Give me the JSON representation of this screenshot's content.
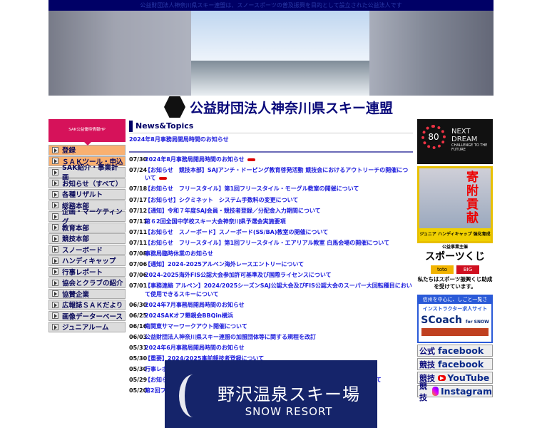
{
  "top_banner": "公益財団法人神奈川県スキー連盟は、スノースポーツの普及振興を目的として設立された公益法人です",
  "org_name": "公益財団法人神奈川県スキー連盟",
  "left": {
    "banner": "SAK公益優待情報HP",
    "menu": [
      "登録",
      "ＳＡＫツール・申込",
      "SAK紹介・事業計画",
      "お知らせ（すべて）",
      "各種リザルト",
      "総務本部",
      "企画・マーケティング",
      "教育本部",
      "競技本部",
      "スノーボード",
      "ハンディキャップ",
      "行事レポート",
      "協会とクラブの紹介",
      "協賛企業",
      "広報誌ＳＡＫだより",
      "画像データーベース",
      "ジュニアルーム"
    ]
  },
  "news": {
    "title": "News&Topics",
    "latest": "2024年8月事務局開局時間のお知らせ",
    "items": [
      {
        "date": "07/30",
        "title": "2024年8月事務局開局時間のお知らせ",
        "new": true
      },
      {
        "date": "07/24",
        "title": "【お知らせ　競技本部】SAJアンチ・ドーピング教育啓発活動 競技会におけるアウトリーチの開催について",
        "new": true
      },
      {
        "date": "07/18",
        "title": "【お知らせ　フリースタイル】第1回フリースタイル・モーグル教室の開催について"
      },
      {
        "date": "07/17",
        "title": "【お知らせ】シクミネット　システム手数料の変更について"
      },
      {
        "date": "07/12",
        "title": "【通知】令和７年度SAJ会員・競技者登録／分配金入力期間について"
      },
      {
        "date": "07/11",
        "title": "第６2回全国中学校スキー大会神奈川県予選会実施要項"
      },
      {
        "date": "07/11",
        "title": "【お知らせ　スノーボード】スノーボード(SS/BA)教室の開催について"
      },
      {
        "date": "07/11",
        "title": "【お知らせ　フリースタイル】第1回フリースタイル・エアリアル教室 白馬会場の開催について"
      },
      {
        "date": "07/08",
        "title": "事務局臨時休業のお知らせ"
      },
      {
        "date": "07/06",
        "title": "【通知】2024-2025アルペン海外レースエントリーについて"
      },
      {
        "date": "07/06",
        "title": "2024-2025海外FIS公認大会参加許可基準及び国際ライセンスについて"
      },
      {
        "date": "07/01",
        "title": "【事務連絡 アルペン】2024/2025シーズンSAJ公認大会及びFIS公認大会のスーパー大回転種目において使用できるスキーについて"
      },
      {
        "date": "06/30",
        "title": "2024年7月事務局開局時間のお知らせ"
      },
      {
        "date": "06/25",
        "title": "2024SAKオフ懇親会BBQin横浜"
      },
      {
        "date": "06/16",
        "title": "南関東サマーワークアウト開催について"
      },
      {
        "date": "06/03",
        "title": "公益財団法人神奈川県スキー連盟の加盟団体等に関する規程を改訂"
      },
      {
        "date": "05/31",
        "title": "2024年6月事務局開局時間のお知らせ"
      },
      {
        "date": "05/30",
        "title": "【重要】2024/2025事前競技者登録について"
      },
      {
        "date": "05/30",
        "title": "行事レポート：市町村対抗スキー競技会"
      },
      {
        "date": "05/29",
        "title": "【お知らせ　フリースタイル】第3回スキーハーフパイプ選手発掘プログラムの開催について"
      },
      {
        "date": "05/20",
        "title": "第2回フリースタイルモーグルキャンプ"
      }
    ]
  },
  "right": {
    "next_dream": "NEXT DREAM",
    "next_dream_sub": "CHALLENGE TO THE FUTURE",
    "anniv": "80",
    "kifu": "寄附貢献",
    "kifu_sub": "ジュニア ハンディキャップ 強化育成 公益事業主催",
    "toto_logo": "スポーツくじ",
    "toto": "toto",
    "big": "BIG",
    "toto_note": "私たちはスポーツ振興くじ助成を受けています。",
    "scoach_top": "信州を中心に、しごと一覧さん！",
    "scoach_sub": "インストラクター求人サイト",
    "scoach": "SCoach",
    "scoach_small": "for SNOW",
    "social": [
      {
        "label": "公式",
        "service": "facebook"
      },
      {
        "label": "競技",
        "service": "facebook"
      },
      {
        "label": "競技",
        "service": "YouTube"
      },
      {
        "label": "競技",
        "service": "Instagram"
      }
    ]
  },
  "bottom_banner": {
    "jp": "野沢温泉スキー場",
    "en": "SNOW RESORT"
  }
}
